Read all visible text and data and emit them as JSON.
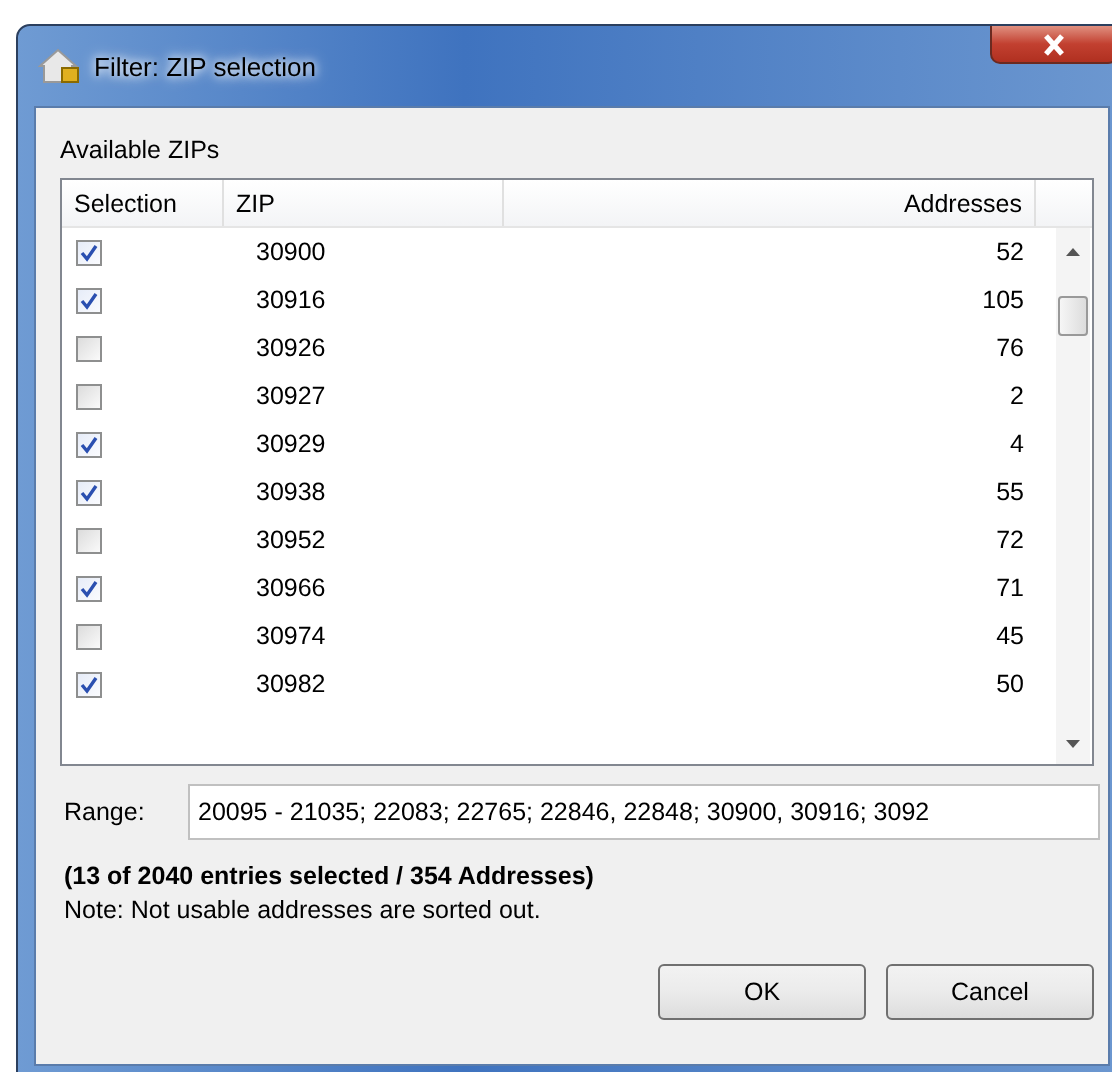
{
  "window": {
    "title": "Filter: ZIP selection"
  },
  "group_label": "Available ZIPs",
  "table": {
    "columns": [
      "Selection",
      "ZIP",
      "Addresses"
    ],
    "rows": [
      {
        "checked": true,
        "zip": "30900",
        "addresses": "52"
      },
      {
        "checked": true,
        "zip": "30916",
        "addresses": "105"
      },
      {
        "checked": false,
        "zip": "30926",
        "addresses": "76"
      },
      {
        "checked": false,
        "zip": "30927",
        "addresses": "2"
      },
      {
        "checked": true,
        "zip": "30929",
        "addresses": "4"
      },
      {
        "checked": true,
        "zip": "30938",
        "addresses": "55"
      },
      {
        "checked": false,
        "zip": "30952",
        "addresses": "72"
      },
      {
        "checked": true,
        "zip": "30966",
        "addresses": "71"
      },
      {
        "checked": false,
        "zip": "30974",
        "addresses": "45"
      },
      {
        "checked": true,
        "zip": "30982",
        "addresses": "50"
      }
    ]
  },
  "range": {
    "label": "Range:",
    "value": "20095 - 21035; 22083; 22765; 22846, 22848; 30900, 30916; 3092"
  },
  "summary": "(13 of 2040 entries selected / 354 Addresses)",
  "note": "Note: Not usable addresses are sorted out.",
  "buttons": [
    "OK",
    "Cancel"
  ]
}
